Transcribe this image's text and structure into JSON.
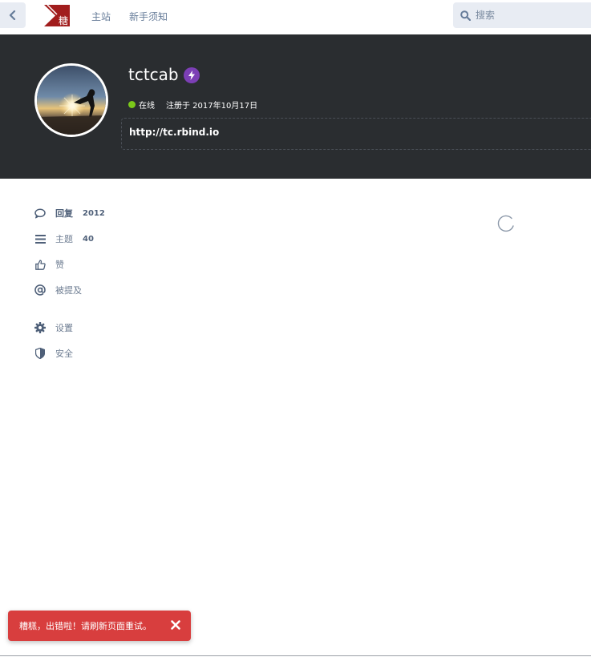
{
  "header": {
    "logo_text": "糖",
    "nav": [
      {
        "label": "主站"
      },
      {
        "label": "新手须知"
      }
    ],
    "search": {
      "placeholder": "搜索"
    }
  },
  "profile": {
    "username": "tctcab",
    "status": "在线",
    "registered": "注册于 2017年10月17日",
    "bio": "http://tc.rbind.io",
    "colors": {
      "hero_bg": "#2a2d30",
      "online": "#7bc81a",
      "badge": "#7c3fb5"
    }
  },
  "sidebar": {
    "items": [
      {
        "label": "回复",
        "count": "2012",
        "icon": "comment-icon",
        "active": true
      },
      {
        "label": "主题",
        "count": "40",
        "icon": "list-icon"
      },
      {
        "label": "赞",
        "icon": "thumbs-up-icon"
      },
      {
        "label": "被提及",
        "icon": "at-icon"
      },
      {
        "label": "设置",
        "icon": "gear-icon"
      },
      {
        "label": "安全",
        "icon": "shield-icon"
      }
    ]
  },
  "alert": {
    "message": "糟糕，出错啦！请刷新页面重试。",
    "color": "#d83e3e"
  }
}
